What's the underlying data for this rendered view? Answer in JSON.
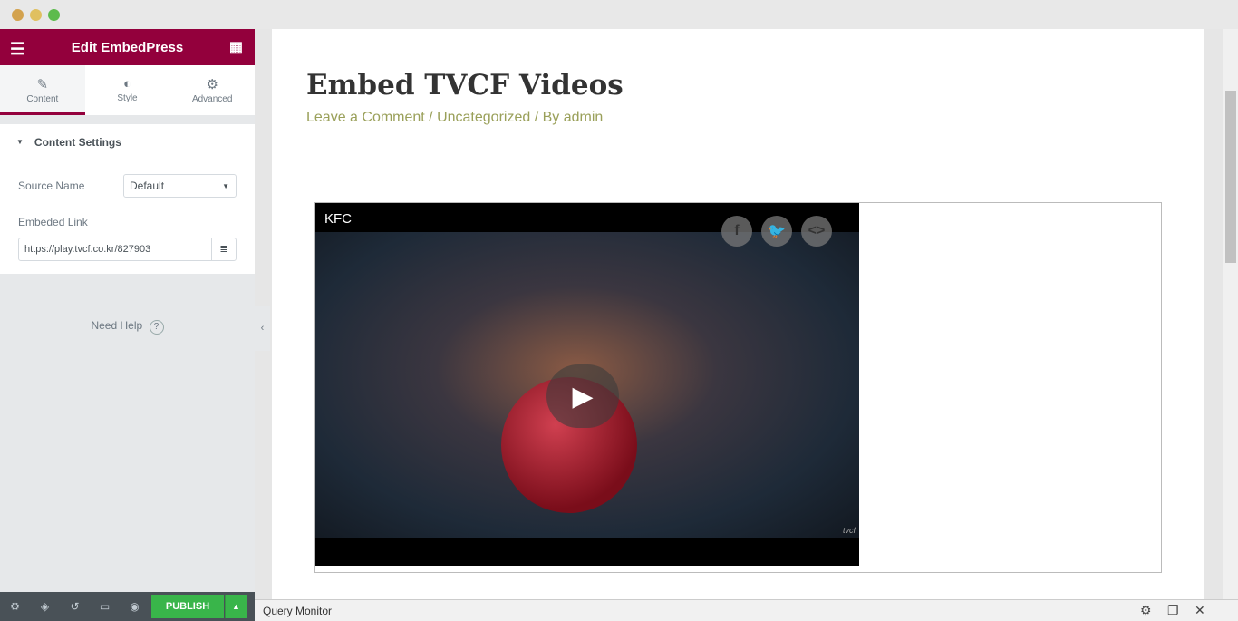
{
  "panel": {
    "title": "Edit EmbedPress",
    "tabs": [
      {
        "label": "Content",
        "icon": "pencil-icon"
      },
      {
        "label": "Style",
        "icon": "half-circle-icon"
      },
      {
        "label": "Advanced",
        "icon": "gear-icon"
      }
    ],
    "section": "Content Settings",
    "source_label": "Source Name",
    "source_value": "Default",
    "link_label": "Embeded Link",
    "link_value": "https://play.tvcf.co.kr/827903",
    "help": "Need Help",
    "publish": "PUBLISH",
    "accent": "#93003c"
  },
  "post": {
    "title": "Embed TVCF Videos",
    "meta_comment": "Leave a Comment",
    "meta_category": "Uncategorized",
    "meta_author": "By admin",
    "separator": " / "
  },
  "video": {
    "title": "KFC",
    "watermark": "tvcf"
  },
  "query_monitor": {
    "label": "Query Monitor"
  }
}
